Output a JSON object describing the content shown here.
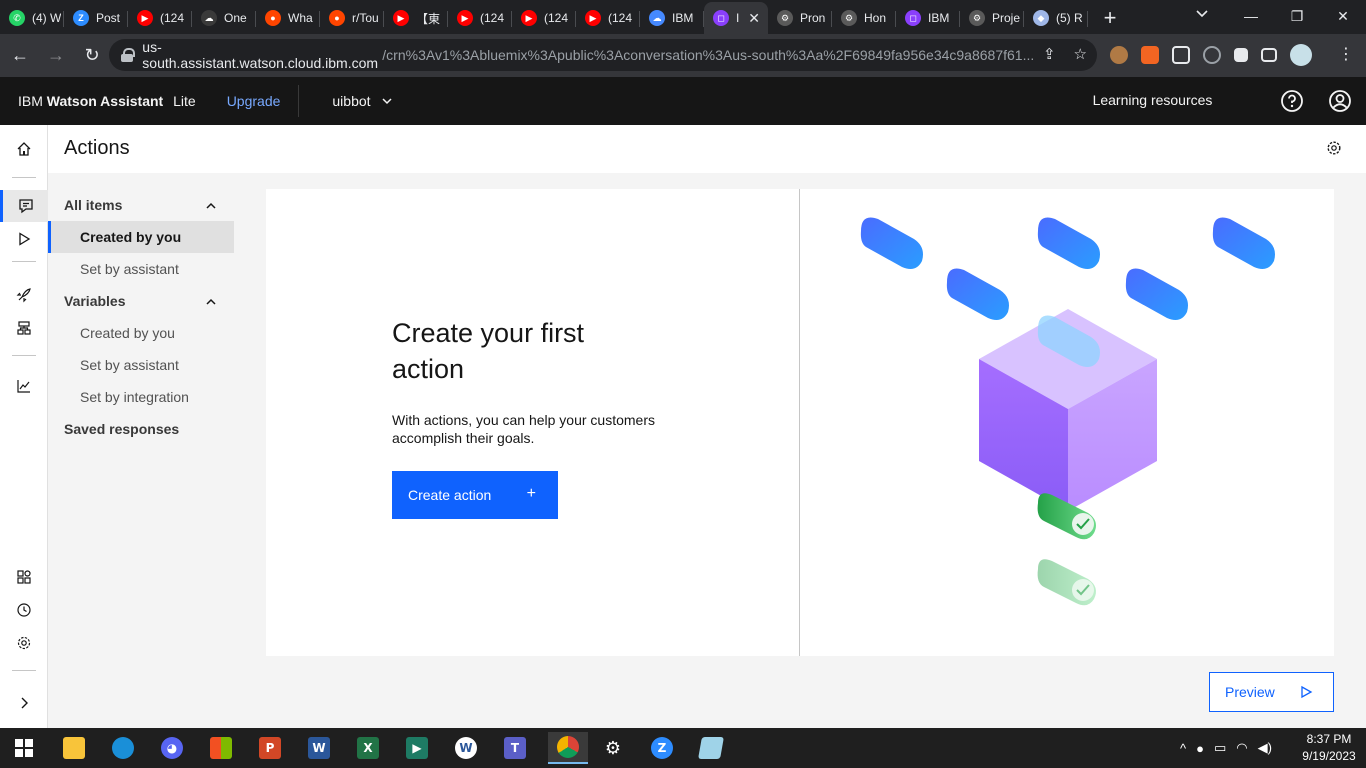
{
  "browser": {
    "tabs": [
      {
        "title": "(4) W",
        "icon": "whatsapp-icon",
        "color": "#25d366",
        "glyph": "✆"
      },
      {
        "title": "Post",
        "icon": "zoom-icon",
        "color": "#2d8cff",
        "glyph": "Z"
      },
      {
        "title": "(124",
        "icon": "youtube-icon",
        "color": "#ff0000",
        "glyph": "▶"
      },
      {
        "title": "One",
        "icon": "onedrive-icon",
        "color": "#3a3a3a",
        "glyph": "☁"
      },
      {
        "title": "Wha",
        "icon": "reddit-icon",
        "color": "#ff4500",
        "glyph": "●"
      },
      {
        "title": "r/Tou",
        "icon": "reddit-icon",
        "color": "#ff4500",
        "glyph": "●"
      },
      {
        "title": "【東",
        "icon": "youtube-icon",
        "color": "#ff0000",
        "glyph": "▶"
      },
      {
        "title": "(124",
        "icon": "youtube-icon",
        "color": "#ff0000",
        "glyph": "▶"
      },
      {
        "title": "(124",
        "icon": "youtube-icon",
        "color": "#ff0000",
        "glyph": "▶"
      },
      {
        "title": "(124",
        "icon": "youtube-icon",
        "color": "#ff0000",
        "glyph": "▶"
      },
      {
        "title": "IBM",
        "icon": "ibm-cloud-icon",
        "color": "#4589ff",
        "glyph": "☁"
      },
      {
        "title": "I",
        "icon": "watson-assistant-icon",
        "color": "#8a3ffc",
        "glyph": "◻",
        "active": true
      },
      {
        "title": "Pron",
        "icon": "node-icon",
        "color": "#5a5a5a",
        "glyph": "⚙"
      },
      {
        "title": "Hon",
        "icon": "node-icon",
        "color": "#5a5a5a",
        "glyph": "⚙"
      },
      {
        "title": "IBM",
        "icon": "watson-assistant-icon",
        "color": "#8a3ffc",
        "glyph": "◻"
      },
      {
        "title": "Proje",
        "icon": "node-icon",
        "color": "#5a5a5a",
        "glyph": "⚙"
      },
      {
        "title": "(5) R",
        "icon": "cube-icon",
        "color": "#9fb7e8",
        "glyph": "◆"
      }
    ],
    "url_host": "us-south.assistant.watson.cloud.ibm.com",
    "url_path": "/crn%3Av1%3Abluemix%3Apublic%3Aconversation%3Aus-south%3Aa%2F69849fa956e34c9a8687f61..."
  },
  "header": {
    "brand_prefix": "IBM",
    "brand_name": "Watson Assistant",
    "tier": "Lite",
    "upgrade": "Upgrade",
    "assistant_name": "uibbot",
    "learning_resources": "Learning resources"
  },
  "page": {
    "title": "Actions"
  },
  "sidenav": {
    "all_items": "All items",
    "created_by_you": "Created by you",
    "set_by_assistant": "Set by assistant",
    "variables": "Variables",
    "var_created_by_you": "Created by you",
    "var_set_by_assistant": "Set by assistant",
    "var_set_by_integration": "Set by integration",
    "saved_responses": "Saved responses"
  },
  "empty_state": {
    "heading": "Create your first action",
    "body": "With actions, you can help your customers accomplish their goals.",
    "button": "Create action",
    "button_icon": "+"
  },
  "preview_button": "Preview",
  "colors": {
    "accent": "#0f62fe",
    "header_bg": "#161616",
    "link": "#78a9ff"
  },
  "taskbar": {
    "apps": [
      "file-explorer-icon",
      "edge-icon",
      "discord-icon",
      "store-icon",
      "powerpoint-icon",
      "word-icon",
      "excel-icon",
      "app-icon",
      "wordpad-icon",
      "teams-icon",
      "chrome-icon",
      "settings-icon",
      "zoom-icon",
      "notepad-icon"
    ],
    "time": "8:37 PM",
    "date": "9/19/2023"
  }
}
